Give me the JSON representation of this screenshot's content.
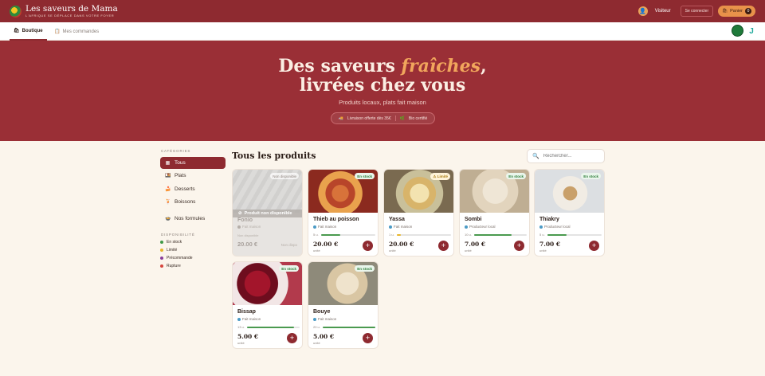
{
  "header": {
    "brand_title": "Les saveurs de Mama",
    "brand_subtitle": "L'AFRIQUE SE DÉPLACE DANS VOTRE FOYER",
    "visitor_label": "Visiteur",
    "login_label": "Se connecter",
    "cart_label": "Panier",
    "cart_count": "0"
  },
  "tabs": [
    {
      "label": "Boutique",
      "active": true
    },
    {
      "label": "Mes commandes",
      "active": false
    }
  ],
  "hero": {
    "title_part1": "Des saveurs ",
    "title_accent": "fraîches",
    "title_part2": ",",
    "title_line2": "livrées chez vous",
    "subtitle": "Produits locaux, plats fait maison",
    "badges": [
      "Livraison offerte dès 35€",
      "Bio certifié"
    ]
  },
  "sidebar": {
    "categories_heading": "CATÉGORIES",
    "categories": [
      {
        "label": "Tous",
        "icon": "grid-icon",
        "active": true
      },
      {
        "label": "Plats",
        "icon": "dish-icon",
        "active": false
      },
      {
        "label": "Desserts",
        "icon": "cake-icon",
        "active": false
      },
      {
        "label": "Boissons",
        "icon": "drink-icon",
        "active": false
      },
      {
        "label": "Nos formules",
        "icon": "formula-icon",
        "active": false
      }
    ],
    "availability_heading": "DISPONIBILITÉ",
    "availability": [
      {
        "label": "En stock",
        "color": "#3f9a47"
      },
      {
        "label": "Limité",
        "color": "#e8b62a"
      },
      {
        "label": "Précommande",
        "color": "#8a3e9a"
      },
      {
        "label": "Rupture",
        "color": "#d6453d"
      }
    ]
  },
  "main": {
    "title": "Tous les produits",
    "search_placeholder": "Rechercher..."
  },
  "products": [
    {
      "name": "Fonio",
      "tag": "Fait maison",
      "stock": "Non disponible",
      "qty_label": "",
      "fill": 0,
      "price": "20.00 €",
      "unit": "",
      "unavailable_label": "Produit non disponible",
      "note": "Non disponible",
      "ghost": "Non dispo"
    },
    {
      "name": "Thieb au poisson",
      "tag": "Fait maison",
      "stock": "En stock",
      "qty_label": "5 u.",
      "fill": 0.35,
      "price": "20.00 €",
      "unit": "unité"
    },
    {
      "name": "Yassa",
      "tag": "Fait maison",
      "stock": "Limité",
      "qty_label": "1 u.",
      "fill": 0.08,
      "price": "20.00 €",
      "unit": "unité"
    },
    {
      "name": "Sombi",
      "tag": "Producteur local",
      "stock": "En stock",
      "qty_label": "10 u.",
      "fill": 0.72,
      "price": "7.00 €",
      "unit": "unité"
    },
    {
      "name": "Thiakry",
      "tag": "Producteur local",
      "stock": "En stock",
      "qty_label": "5 u.",
      "fill": 0.35,
      "price": "7.00 €",
      "unit": "unité"
    },
    {
      "name": "Bissap",
      "tag": "Fait maison",
      "stock": "En stock",
      "qty_label": "13 u.",
      "fill": 0.9,
      "price": "5.00 €",
      "unit": "unité"
    },
    {
      "name": "Bouye",
      "tag": "Fait maison",
      "stock": "En stock",
      "qty_label": "20 u.",
      "fill": 1.0,
      "price": "5.00 €",
      "unit": "unité"
    }
  ],
  "colors": {
    "brand": "#8e2a30",
    "accent": "#f1a65c",
    "cart": "#e8924a",
    "background": "#fbf5ec"
  }
}
